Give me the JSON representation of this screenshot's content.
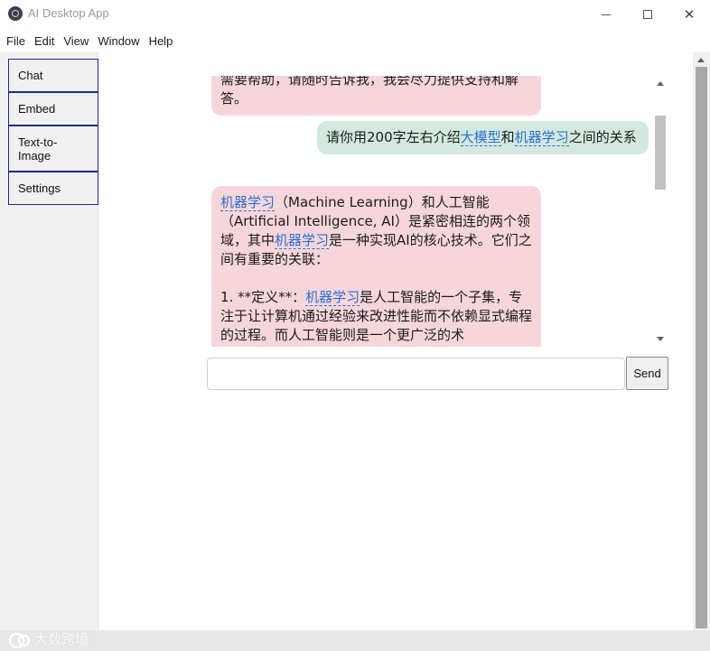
{
  "window": {
    "title": "AI Desktop App",
    "minimize_glyph": "",
    "maximize_glyph": "",
    "close_glyph": "✕"
  },
  "menu": [
    "File",
    "Edit",
    "View",
    "Window",
    "Help"
  ],
  "sidebar": {
    "items": [
      {
        "label": "Chat"
      },
      {
        "label": "Embed"
      },
      {
        "label": "Text-to-Image"
      },
      {
        "label": "Settings"
      }
    ]
  },
  "chat": {
    "messages": [
      {
        "role": "assistant",
        "segments": [
          {
            "text": "需要帮助，请随时告诉我，我会尽力提供支持和解答。",
            "kw": false
          }
        ]
      },
      {
        "role": "user",
        "segments": [
          {
            "text": "请你用200字左右介绍",
            "kw": false
          },
          {
            "text": "大模型",
            "kw": true
          },
          {
            "text": "和",
            "kw": false
          },
          {
            "text": "机器学习",
            "kw": true
          },
          {
            "text": "之间的关系",
            "kw": false
          }
        ]
      },
      {
        "role": "assistant",
        "paragraphs": [
          [
            {
              "text": "机器学习",
              "kw": true
            },
            {
              "text": "（Machine Learning）和人工智能（Artificial Intelligence, AI）是紧密相连的两个领域，其中",
              "kw": false
            },
            {
              "text": "机器学习",
              "kw": true
            },
            {
              "text": "是一种实现AI的核心技术。它们之间有重要的关联：",
              "kw": false
            }
          ],
          [
            {
              "text": "1. **定义**：",
              "kw": false
            },
            {
              "text": "机器学习",
              "kw": true
            },
            {
              "text": "是人工智能的一个子集，专注于让计算机通过经验来改进性能而不依赖显式编程的过程。而人工智能则是一个更广泛的术",
              "kw": false
            }
          ]
        ]
      }
    ]
  },
  "input": {
    "value": "",
    "placeholder": ""
  },
  "send_button": {
    "label": "Send"
  },
  "watermark": {
    "text": "大数跨境"
  },
  "colors": {
    "assistant_bubble": "#f6d6da",
    "user_bubble": "#d3e8de",
    "keyword_link": "#2b6fd3",
    "nav_border": "#1c2a8a"
  }
}
